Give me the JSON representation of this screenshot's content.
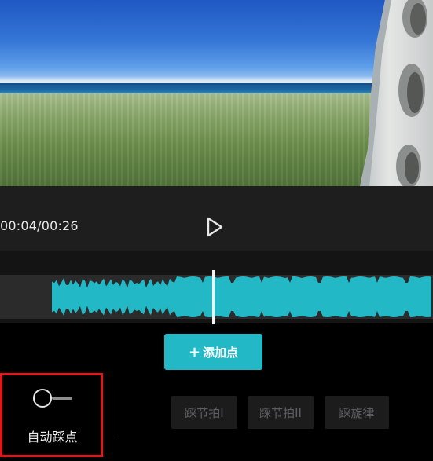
{
  "player": {
    "timecode": "00:04/00:26",
    "play_icon": "play-icon"
  },
  "editor": {
    "add_point_icon": "plus-icon",
    "add_point_label": "添加点",
    "accent_color": "#23b8c6",
    "highlight_color": "#e4161b"
  },
  "auto_beat": {
    "label": "自动踩点",
    "enabled": false
  },
  "beat_options": [
    {
      "label": "踩节拍I"
    },
    {
      "label": "踩节拍II"
    },
    {
      "label": "踩旋律"
    }
  ]
}
